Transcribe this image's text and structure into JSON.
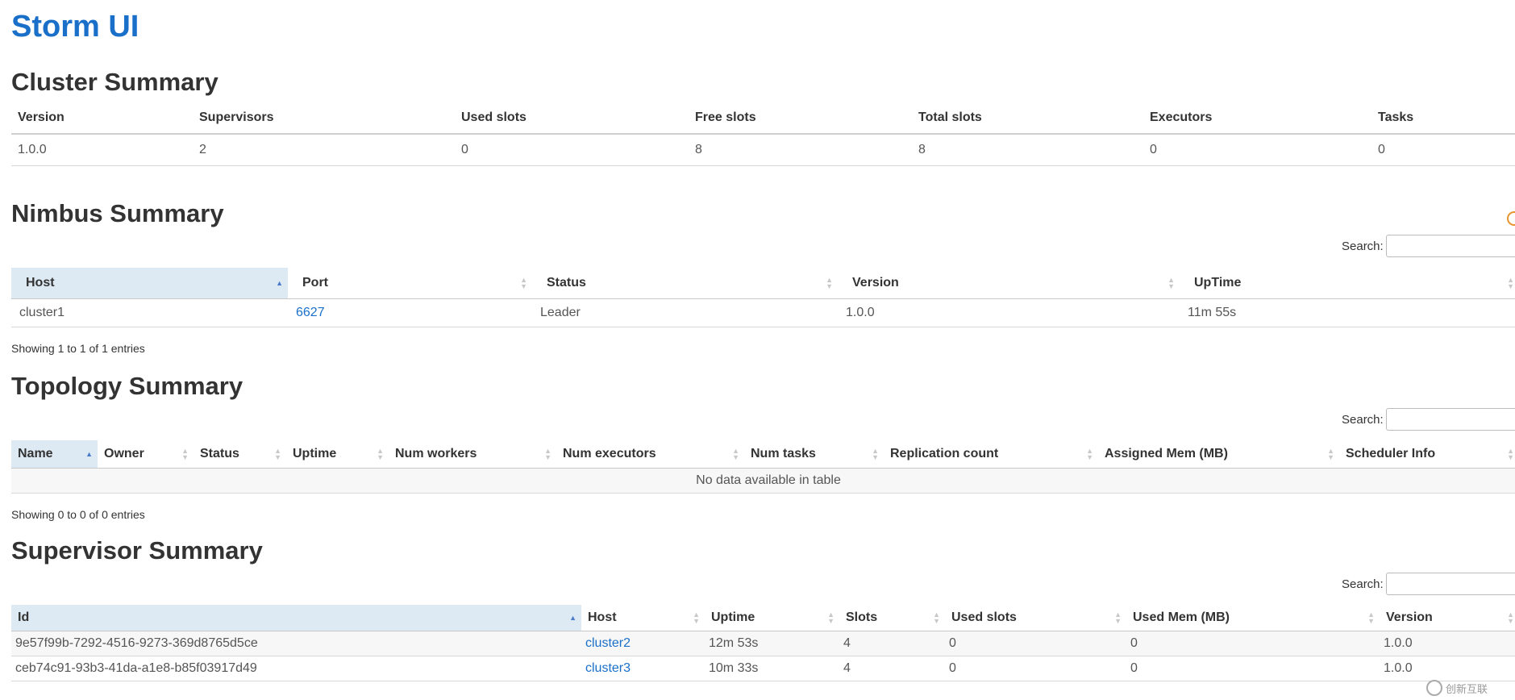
{
  "brand": "Storm UI",
  "cluster": {
    "title": "Cluster Summary",
    "columns": [
      "Version",
      "Supervisors",
      "Used slots",
      "Free slots",
      "Total slots",
      "Executors",
      "Tasks"
    ],
    "row": [
      "1.0.0",
      "2",
      "0",
      "8",
      "8",
      "0",
      "0"
    ]
  },
  "nimbus": {
    "title": "Nimbus Summary",
    "search_label": "Search:",
    "columns": [
      "Host",
      "Port",
      "Status",
      "Version",
      "UpTime"
    ],
    "rows": [
      [
        "cluster1",
        "6627",
        "Leader",
        "1.0.0",
        "11m 55s"
      ]
    ],
    "info": "Showing 1 to 1 of 1 entries"
  },
  "topology": {
    "title": "Topology Summary",
    "search_label": "Search:",
    "columns": [
      "Name",
      "Owner",
      "Status",
      "Uptime",
      "Num workers",
      "Num executors",
      "Num tasks",
      "Replication count",
      "Assigned Mem (MB)",
      "Scheduler Info"
    ],
    "empty": "No data available in table",
    "info": "Showing 0 to 0 of 0 entries"
  },
  "supervisor": {
    "title": "Supervisor Summary",
    "search_label": "Search:",
    "columns": [
      "Id",
      "Host",
      "Uptime",
      "Slots",
      "Used slots",
      "Used Mem (MB)",
      "Version"
    ],
    "rows": [
      [
        "9e57f99b-7292-4516-9273-369d8765d5ce",
        "cluster2",
        "12m 53s",
        "4",
        "0",
        "0",
        "1.0.0"
      ],
      [
        "ceb74c91-93b3-41da-a1e8-b85f03917d49",
        "cluster3",
        "10m 33s",
        "4",
        "0",
        "0",
        "1.0.0"
      ]
    ]
  },
  "watermark": "创新互联"
}
